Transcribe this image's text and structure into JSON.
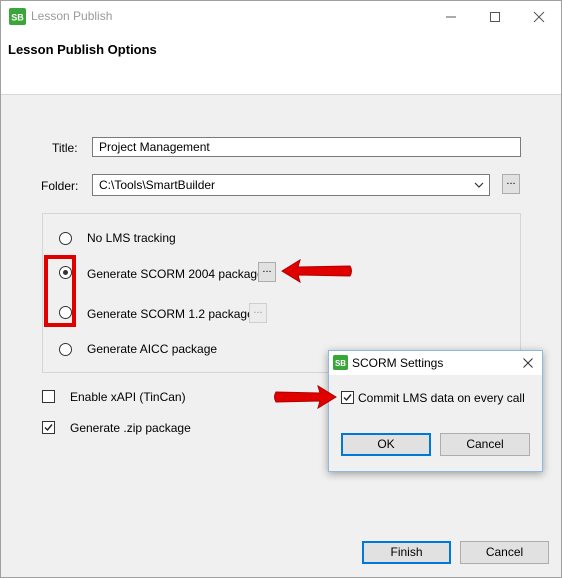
{
  "window": {
    "title": "Lesson Publish"
  },
  "header": {
    "title": "Lesson Publish Options"
  },
  "form": {
    "title_label": "Title:",
    "title_value": "Project Management",
    "folder_label": "Folder:",
    "folder_value": "C:\\Tools\\SmartBuilder",
    "browse_label": "..."
  },
  "tracking": {
    "options": [
      {
        "label": "No LMS tracking",
        "selected": false
      },
      {
        "label": "Generate SCORM 2004 package",
        "selected": true
      },
      {
        "label": "Generate SCORM 1.2 package",
        "selected": false
      },
      {
        "label": "Generate AICC package",
        "selected": false
      }
    ],
    "settings_label": "..."
  },
  "checks": {
    "xapi_label": "Enable xAPI (TinCan)",
    "xapi_checked": false,
    "zip_label": "Generate .zip package",
    "zip_checked": true
  },
  "footer": {
    "finish_label": "Finish",
    "cancel_label": "Cancel"
  },
  "scorm_dialog": {
    "title": "SCORM Settings",
    "commit_label": "Commit LMS data on every call",
    "commit_checked": true,
    "ok_label": "OK",
    "cancel_label": "Cancel"
  },
  "colors": {
    "accent": "#0078d7",
    "annotation": "#e00000",
    "app_icon": "#3aa63a"
  }
}
